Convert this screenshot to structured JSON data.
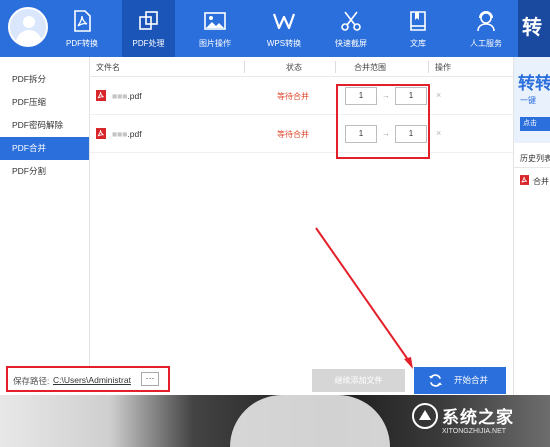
{
  "nav": {
    "tabs": [
      {
        "label": "PDF转换",
        "icon": "pdf-icon"
      },
      {
        "label": "PDF处理",
        "icon": "pdf-process-icon",
        "active": true
      },
      {
        "label": "图片操作",
        "icon": "image-icon"
      },
      {
        "label": "WPS转换",
        "icon": "wps-icon"
      },
      {
        "label": "快速截屏",
        "icon": "scissors-icon"
      },
      {
        "label": "文库",
        "icon": "library-icon"
      },
      {
        "label": "人工服务",
        "icon": "support-icon"
      }
    ],
    "brand_corner": "转"
  },
  "sidebar": {
    "items": [
      {
        "label": "PDF拆分"
      },
      {
        "label": "PDF压缩"
      },
      {
        "label": "PDF密码解除"
      },
      {
        "label": "PDF合并",
        "active": true
      },
      {
        "label": "PDF分割"
      }
    ]
  },
  "table": {
    "headers": {
      "filename": "文件名",
      "status": "状态",
      "range": "合并范围",
      "action": "操作"
    },
    "rows": [
      {
        "name_hidden": "■■■",
        "name_visible": ".pdf",
        "status": "等待合并",
        "range_from": "1",
        "range_to": "1",
        "delete": "×"
      },
      {
        "name_hidden": "■■■",
        "name_visible": ".pdf",
        "status": "等待合并",
        "range_from": "1",
        "range_to": "1",
        "delete": "×"
      }
    ],
    "range_arrow": "→"
  },
  "footer": {
    "save_label": "保存路径:",
    "save_path": "C:\\Users\\Administrat",
    "more_label": "···",
    "add_label": "继续添加文件",
    "merge_label": "开始合并"
  },
  "right_panel": {
    "promo_title": "转转",
    "promo_sub": "一键",
    "promo_more": "点击",
    "history_label": "历史列表",
    "history_item": "合并"
  },
  "watermark": {
    "text": "系统之家",
    "url": "XITONGZHIJIA.NET"
  },
  "colors": {
    "brand": "#2b6fdc",
    "status": "#e0462b",
    "highlight": "#e3202a"
  }
}
